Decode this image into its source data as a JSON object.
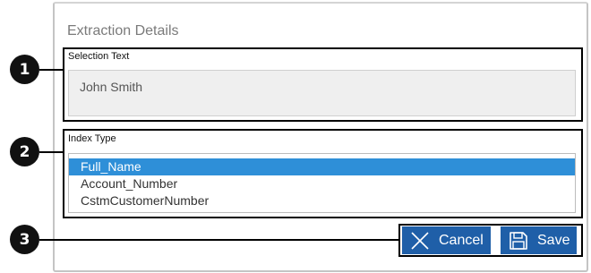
{
  "dialog": {
    "title": "Extraction Details"
  },
  "selection": {
    "label": "Selection Text",
    "value": "John Smith"
  },
  "index_type": {
    "label": "Index Type",
    "options": [
      "Full_Name",
      "Account_Number",
      "CstmCustomerNumber"
    ],
    "selected": "Full_Name"
  },
  "actions": {
    "cancel_label": "Cancel",
    "save_label": "Save",
    "cancel_icon": "close-x-icon",
    "save_icon": "floppy-disk-icon"
  },
  "callouts": [
    "1",
    "2",
    "3"
  ],
  "colors": {
    "button_bg": "#1f5fa8",
    "selection_bg": "#2e8fd8",
    "callout_bg": "#111111"
  }
}
